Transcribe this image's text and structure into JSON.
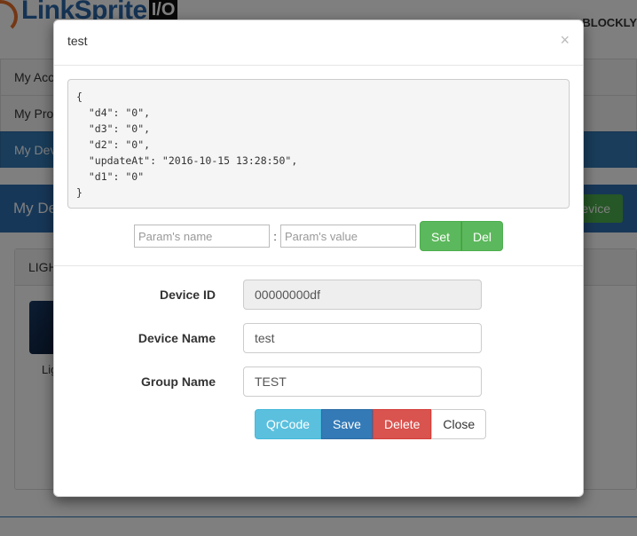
{
  "background": {
    "brand_name": "LinkSprite",
    "brand_badge": "I/O",
    "top_right_link": "BLOCKLY",
    "nav": [
      {
        "label": "My Acco"
      },
      {
        "label": "My Prof"
      },
      {
        "label": "My Dev"
      }
    ],
    "devices_title": "My De",
    "add_device_label": "evice",
    "card_title": "LIGH",
    "card_subtitle": "Lig"
  },
  "modal": {
    "title": "test",
    "close_glyph": "×",
    "json_text": "{\n  \"d4\": \"0\",\n  \"d3\": \"0\",\n  \"d2\": \"0\",\n  \"updateAt\": \"2016-10-15 13:28:50\",\n  \"d1\": \"0\"\n}",
    "param_name_placeholder": "Param's name",
    "param_separator": ":",
    "param_value_placeholder": "Param's value",
    "set_label": "Set",
    "del_label": "Del",
    "fields": {
      "device_id": {
        "label": "Device ID",
        "value": "00000000df"
      },
      "device_name": {
        "label": "Device Name",
        "value": "test"
      },
      "group_name": {
        "label": "Group Name",
        "value": "TEST"
      }
    },
    "buttons": {
      "qrcode": "QrCode",
      "save": "Save",
      "delete": "Delete",
      "close": "Close"
    }
  },
  "colors": {
    "primary": "#337ab7",
    "success": "#5cb85c",
    "info": "#5bc0de",
    "danger": "#d9534f"
  }
}
